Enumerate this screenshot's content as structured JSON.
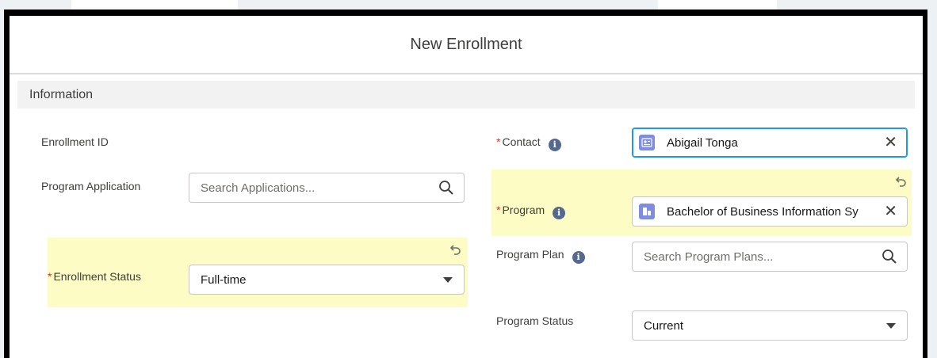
{
  "modal": {
    "title": "New Enrollment"
  },
  "section": {
    "title": "Information"
  },
  "fields": {
    "enrollment_id": {
      "label": "Enrollment ID"
    },
    "program_application": {
      "label": "Program Application",
      "placeholder": "Search Applications..."
    },
    "enrollment_status": {
      "label": "Enrollment Status",
      "value": "Full-time"
    },
    "contact": {
      "label": "Contact",
      "value": "Abigail Tonga"
    },
    "program": {
      "label": "Program",
      "value": "Bachelor of Business Information Sy"
    },
    "program_plan": {
      "label": "Program Plan",
      "placeholder": "Search Program Plans..."
    },
    "program_status": {
      "label": "Program Status",
      "value": "Current"
    }
  },
  "icons": {
    "info": "i",
    "clear": "✕"
  },
  "colors": {
    "required": "#c23934",
    "highlight": "#fcfcc4",
    "contact_icon": "#7f8de1",
    "program_icon": "#7f8de1",
    "focus_border": "#1b96ff"
  }
}
